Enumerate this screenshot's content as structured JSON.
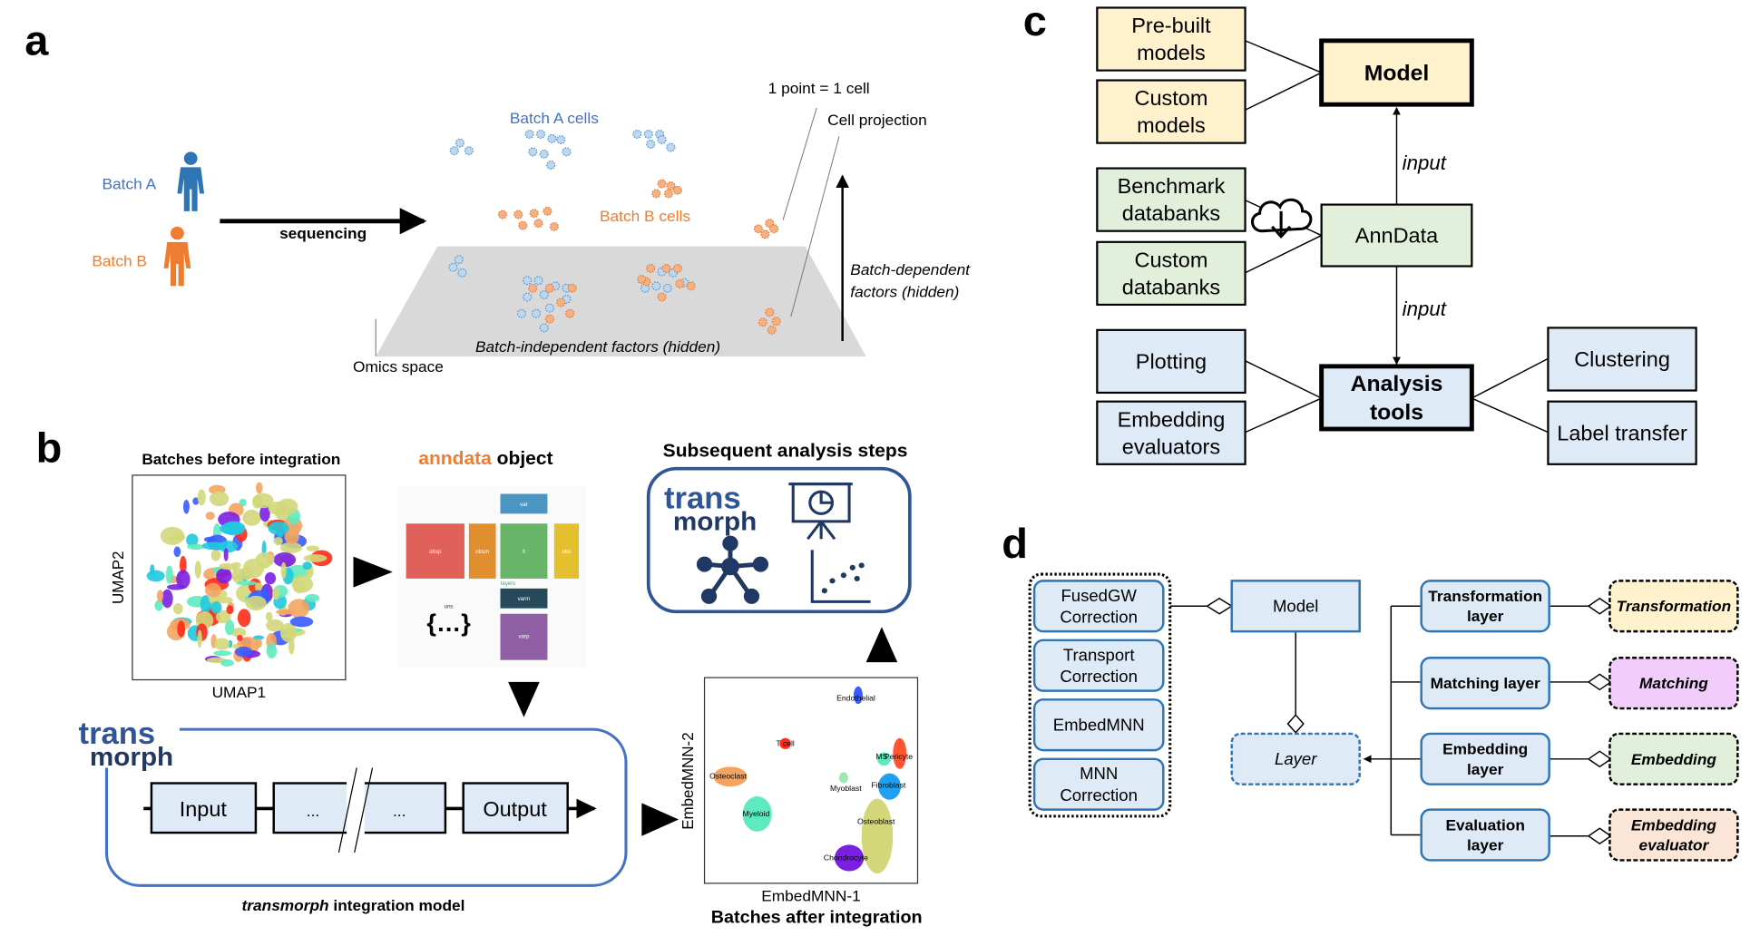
{
  "colors": {
    "batch_a": "#4472C4",
    "batch_b": "#ED7D31",
    "model_fill": "#FFF2CC",
    "data_fill": "#E2EFDA",
    "tool_fill": "#DEEBF7",
    "matching_fill": "#F2CCFA",
    "evaluator_fill": "#FBE5D6",
    "navy": "#1F3864",
    "plane": "#D9D9D9"
  },
  "panel_a": {
    "label": "a",
    "batch_a": "Batch A",
    "batch_b": "Batch B",
    "sequencing": "sequencing",
    "batch_a_cells": "Batch A cells",
    "batch_b_cells": "Batch B cells",
    "one_point": "1 point = 1 cell",
    "cell_projection": "Cell projection",
    "batch_dependent_1": "Batch-dependent",
    "batch_dependent_2": "factors (hidden)",
    "batch_independent": "Batch-independent factors (hidden)",
    "omics_space": "Omics space",
    "icons": [
      "person-icon",
      "person-icon"
    ]
  },
  "panel_b": {
    "label": "b",
    "before_title": "Batches before integration",
    "umap1": "UMAP1",
    "umap2": "UMAP2",
    "anndata_title_accent": "anndata",
    "anndata_title_rest": " object",
    "anndata_parts": {
      "var": "var",
      "obsp": "obsp",
      "obsm": "obsm",
      "x": "X",
      "obs": "obs",
      "varm": "varm",
      "varp": "varp",
      "uns": "uns",
      "layers": "layers",
      "uns_glyph": "{…}"
    },
    "subsequent_title": "Subsequent analysis steps",
    "logo_top": "trans",
    "logo_bottom": "morph",
    "pipeline": {
      "input": "Input",
      "mid1": "...",
      "mid2": "...",
      "output": "Output"
    },
    "model_caption_italic": "transmorph",
    "model_caption_rest": " integration model",
    "after_title": "Batches after integration",
    "embed1": "EmbedMNN-1",
    "embed2": "EmbedMNN-2",
    "cell_types": [
      "Endothelial",
      "T cell",
      "MS",
      "Pericyte",
      "Osteoclast",
      "Myoblast",
      "Fibroblast",
      "Myeloid",
      "Osteoblast",
      "Chondrocyte"
    ],
    "icons": [
      "presentation-chart-icon",
      "network-icon",
      "scatter-plot-icon"
    ]
  },
  "panel_c": {
    "label": "c",
    "prebuilt": [
      "Pre-built",
      "models"
    ],
    "custom_models": [
      "Custom",
      "models"
    ],
    "model": "Model",
    "benchmark": [
      "Benchmark",
      "databanks"
    ],
    "custom_databanks": [
      "Custom",
      "databanks"
    ],
    "anndata": "AnnData",
    "plotting": "Plotting",
    "embedding_evaluators": [
      "Embedding",
      "evaluators"
    ],
    "analysis_tools": [
      "Analysis",
      "tools"
    ],
    "clustering": "Clustering",
    "label_transfer": "Label transfer",
    "input1": "input",
    "input2": "input",
    "icons": [
      "cloud-download-icon"
    ]
  },
  "panel_d": {
    "label": "d",
    "implementations": [
      [
        "FusedGW",
        "Correction"
      ],
      [
        "Transport",
        "Correction"
      ],
      [
        "EmbedMNN"
      ],
      [
        "MNN",
        "Correction"
      ]
    ],
    "model": "Model",
    "layer": "Layer",
    "layers": [
      [
        "Transformation",
        "layer"
      ],
      [
        "Matching layer"
      ],
      [
        "Embedding",
        "layer"
      ],
      [
        "Evaluation",
        "layer"
      ]
    ],
    "components": [
      [
        "Transformation"
      ],
      [
        "Matching"
      ],
      [
        "Embedding"
      ],
      [
        "Embedding",
        "evaluator"
      ]
    ]
  }
}
